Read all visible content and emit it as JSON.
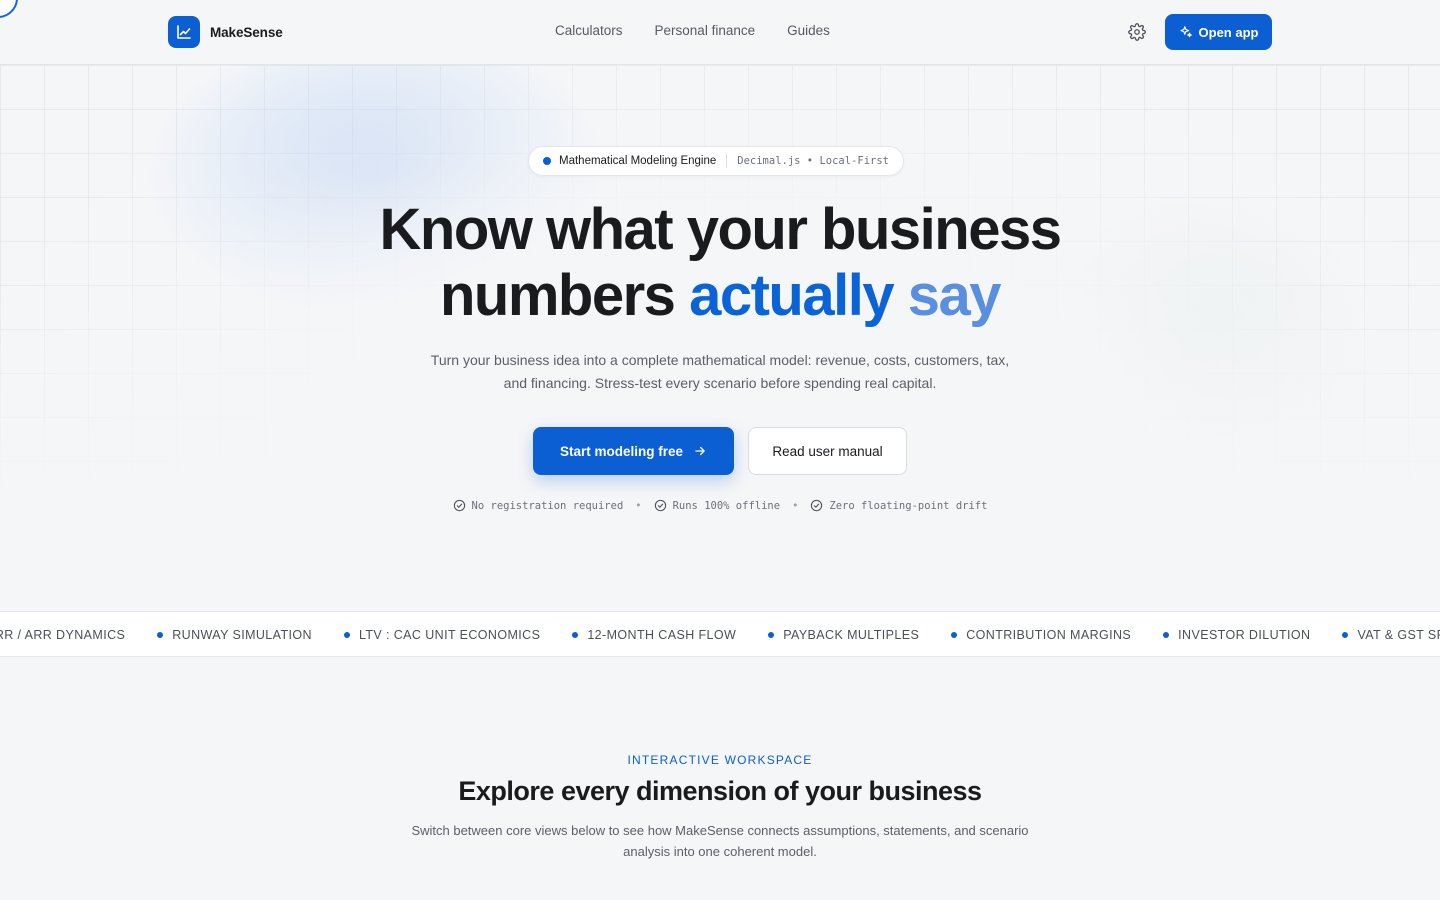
{
  "header": {
    "brand_name": "MakeSense",
    "nav": [
      "Calculators",
      "Personal finance",
      "Guides"
    ],
    "open_app_label": "Open app"
  },
  "hero": {
    "pill_label": "Mathematical Modeling Engine",
    "pill_meta": "Decimal.js • Local-First",
    "title_line1": "Know what your business",
    "title_line2_plain": "numbers",
    "title_line2_accent1": "actually",
    "title_line2_accent2": "say",
    "subtitle": "Turn your business idea into a complete mathematical model: revenue, costs, customers, tax, and financing. Stress-test every scenario before spending real capital.",
    "primary_cta": "Start modeling free",
    "secondary_cta": "Read user manual",
    "checks": [
      "No registration required",
      "Runs 100% offline",
      "Zero floating-point drift"
    ]
  },
  "ticker": [
    "MRR / ARR DYNAMICS",
    "RUNWAY SIMULATION",
    "LTV : CAC UNIT ECONOMICS",
    "12-MONTH CASH FLOW",
    "PAYBACK MULTIPLES",
    "CONTRIBUTION MARGINS",
    "INVESTOR DILUTION",
    "VAT & GST SPLIT"
  ],
  "workspace": {
    "eyebrow": "INTERACTIVE WORKSPACE",
    "title": "Explore every dimension of your business",
    "subtitle": "Switch between core views below to see how MakeSense connects assumptions, statements, and scenario analysis into one coherent model."
  },
  "colors": {
    "brand": "#0b5fd3",
    "accent_light": "#5a8fe0",
    "page_bg": "#f5f6f8",
    "text": "#1a1b1e"
  }
}
